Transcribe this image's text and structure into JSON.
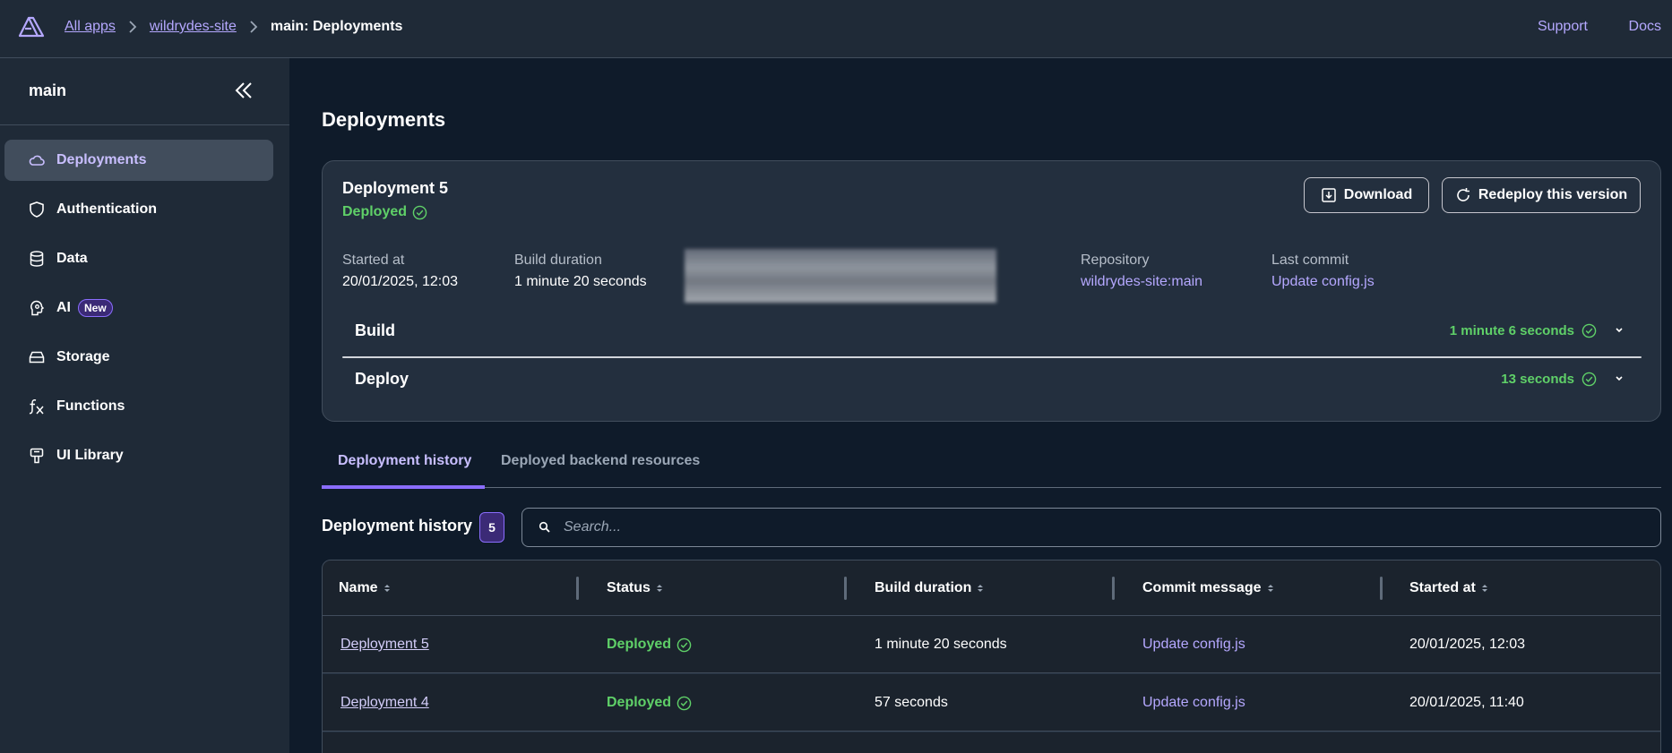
{
  "topbar": {
    "breadcrumbs": [
      "All apps",
      "wildrydes-site"
    ],
    "current": "main: Deployments",
    "support": "Support",
    "docs": "Docs"
  },
  "sidebar": {
    "title": "main",
    "items": [
      {
        "label": "Deployments",
        "icon": "cloud-icon"
      },
      {
        "label": "Authentication",
        "icon": "shield-icon"
      },
      {
        "label": "Data",
        "icon": "database-icon"
      },
      {
        "label": "AI",
        "icon": "ai-brain-icon",
        "badge": "New"
      },
      {
        "label": "Storage",
        "icon": "storage-icon"
      },
      {
        "label": "Functions",
        "icon": "function-icon"
      },
      {
        "label": "UI Library",
        "icon": "ui-library-icon"
      }
    ]
  },
  "main": {
    "title": "Deployments",
    "deployment": {
      "name": "Deployment 5",
      "status": "Deployed",
      "download_label": "Download",
      "redeploy_label": "Redeploy this version",
      "started_label": "Started at",
      "started_value": "20/01/2025, 12:03",
      "duration_label": "Build duration",
      "duration_value": "1 minute 20 seconds",
      "repo_label": "Repository",
      "repo_value": "wildrydes-site:main",
      "commit_label": "Last commit",
      "commit_value": "Update config.js",
      "build_label": "Build",
      "build_time": "1 minute 6 seconds",
      "deploy_label": "Deploy",
      "deploy_time": "13 seconds"
    },
    "tabs": [
      "Deployment history",
      "Deployed backend resources"
    ],
    "history": {
      "title": "Deployment history",
      "count": "5",
      "search_placeholder": "Search...",
      "columns": [
        "Name",
        "Status",
        "Build duration",
        "Commit message",
        "Started at"
      ],
      "rows": [
        {
          "name": "Deployment 5",
          "status": "Deployed",
          "duration": "1 minute 20 seconds",
          "commit": "Update config.js",
          "started": "20/01/2025, 12:03"
        },
        {
          "name": "Deployment 4",
          "status": "Deployed",
          "duration": "57 seconds",
          "commit": "Update config.js",
          "started": "20/01/2025, 11:40"
        }
      ]
    }
  },
  "colors": {
    "accent": "#b5a8ff",
    "success": "#5fd068",
    "background": "#0f1b2a",
    "surface": "#232f3e"
  }
}
